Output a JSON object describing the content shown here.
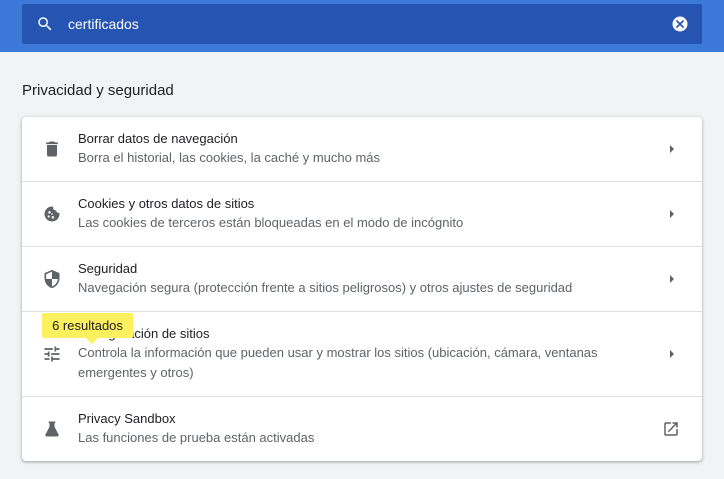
{
  "search": {
    "query": "certificados"
  },
  "section": {
    "title": "Privacidad y seguridad"
  },
  "items": [
    {
      "title": "Borrar datos de navegación",
      "subtitle": "Borra el historial, las cookies, la caché y mucho más",
      "icon": "trash-icon",
      "action": "chevron-right-icon"
    },
    {
      "title": "Cookies y otros datos de sitios",
      "subtitle": "Las cookies de terceros están bloqueadas en el modo de incógnito",
      "icon": "cookie-icon",
      "action": "chevron-right-icon"
    },
    {
      "title": "Seguridad",
      "subtitle": "Navegación segura (protección frente a sitios peligrosos) y otros ajustes de seguridad",
      "icon": "shield-icon",
      "action": "chevron-right-icon"
    },
    {
      "title": "Configuración de sitios",
      "subtitle": "Controla la información que pueden usar y mostrar los sitios (ubicación, cámara, ventanas emergentes y otros)",
      "icon": "tune-icon",
      "action": "chevron-right-icon"
    },
    {
      "title": "Privacy Sandbox",
      "subtitle": "Las funciones de prueba están activadas",
      "icon": "flask-icon",
      "action": "open-in-new-icon"
    }
  ],
  "tooltip": {
    "text": "6 resultados"
  },
  "colors": {
    "header": "#3c78d8",
    "searchbox": "#2654b3",
    "highlight": "#fdf05f",
    "background": "#f1f3f4"
  }
}
